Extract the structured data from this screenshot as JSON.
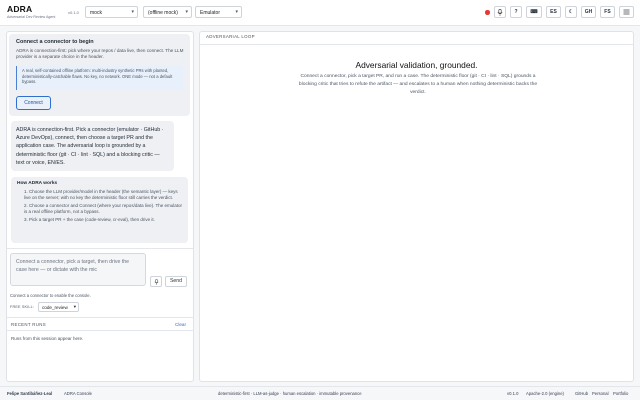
{
  "header": {
    "title": "ADRA",
    "subtitle": "Adversarial Dev Review Agent",
    "version": "v0.1.0",
    "provider_select": "mock",
    "model_select": "(offline mock)",
    "connector_select": "Emulator",
    "buttons": {
      "help": "?",
      "keyboard": "⌨",
      "lang_es": "ES",
      "theme": "☾",
      "github": "GH",
      "fs": "FS"
    },
    "status_color": "#e53935"
  },
  "left": {
    "connect_card": {
      "title": "Connect a connector to begin",
      "description": "ADRA is connection-first: pick where your repos / data live, then connect. The LLM provider is a separate choice in the header.",
      "info": "A real, self-contained offline platform: multi-industry synthetic PRs with planted, deterministically-catchable flaws. No key, no network. ONE mode — not a default bypass.",
      "connect_label": "Connect"
    },
    "intro_message": "ADRA is connection-first. Pick a connector (emulator · GitHub · Azure DevOps), connect, then choose a target PR and the application case. The adversarial loop is grounded by a deterministic floor (git · CI · lint · SQL) and a blocking critic — text or voice, EN/ES.",
    "howto": {
      "title": "How ADRA works",
      "steps": [
        "1. Choose the LLM provider/model in the header (the semantic layer) — keys live on the server; with no key the deterministic floor still carries the verdict.",
        "2. Choose a connector and Connect (where your repos/data live). The emulator is a real offline platform, not a bypass.",
        "3. Pick a target PR + the case (code-review, cr-eval), then drive it."
      ]
    },
    "composer": {
      "placeholder": "Connect a connector, pick a target, then drive the case here — or dictate with the mic",
      "mic_label": "🎙",
      "send_label": "Send",
      "hint": "Connect a connector to enable the console.",
      "free_skill_label": "FREE SKILL:",
      "free_skill_value": "code_review"
    },
    "recent": {
      "title": "RECENT RUNS",
      "clear_label": "Clear",
      "empty_text": "Runs from this session appear here."
    }
  },
  "main": {
    "section_label": "ADVERSARIAL LOOP",
    "hero_title": "Adversarial validation, grounded.",
    "hero_desc": "Connect a connector, pick a target PR, and run a case. The deterministic floor (git · CI · lint · SQL) grounds a blocking critic that tries to refute the artifact — and escalates to a human when nothing deterministic backs the verdict."
  },
  "footer": {
    "author": "Felipe Santibáñez-Leal",
    "app": "ADRA Console",
    "tagline": "deterministic-first · LLM-as-judge · human escalation · immutable provenance",
    "version": "v0.1.0",
    "license": "Apache-2.0 (engine)",
    "links": [
      "GitHub",
      "Personal",
      "Portfolio"
    ]
  }
}
